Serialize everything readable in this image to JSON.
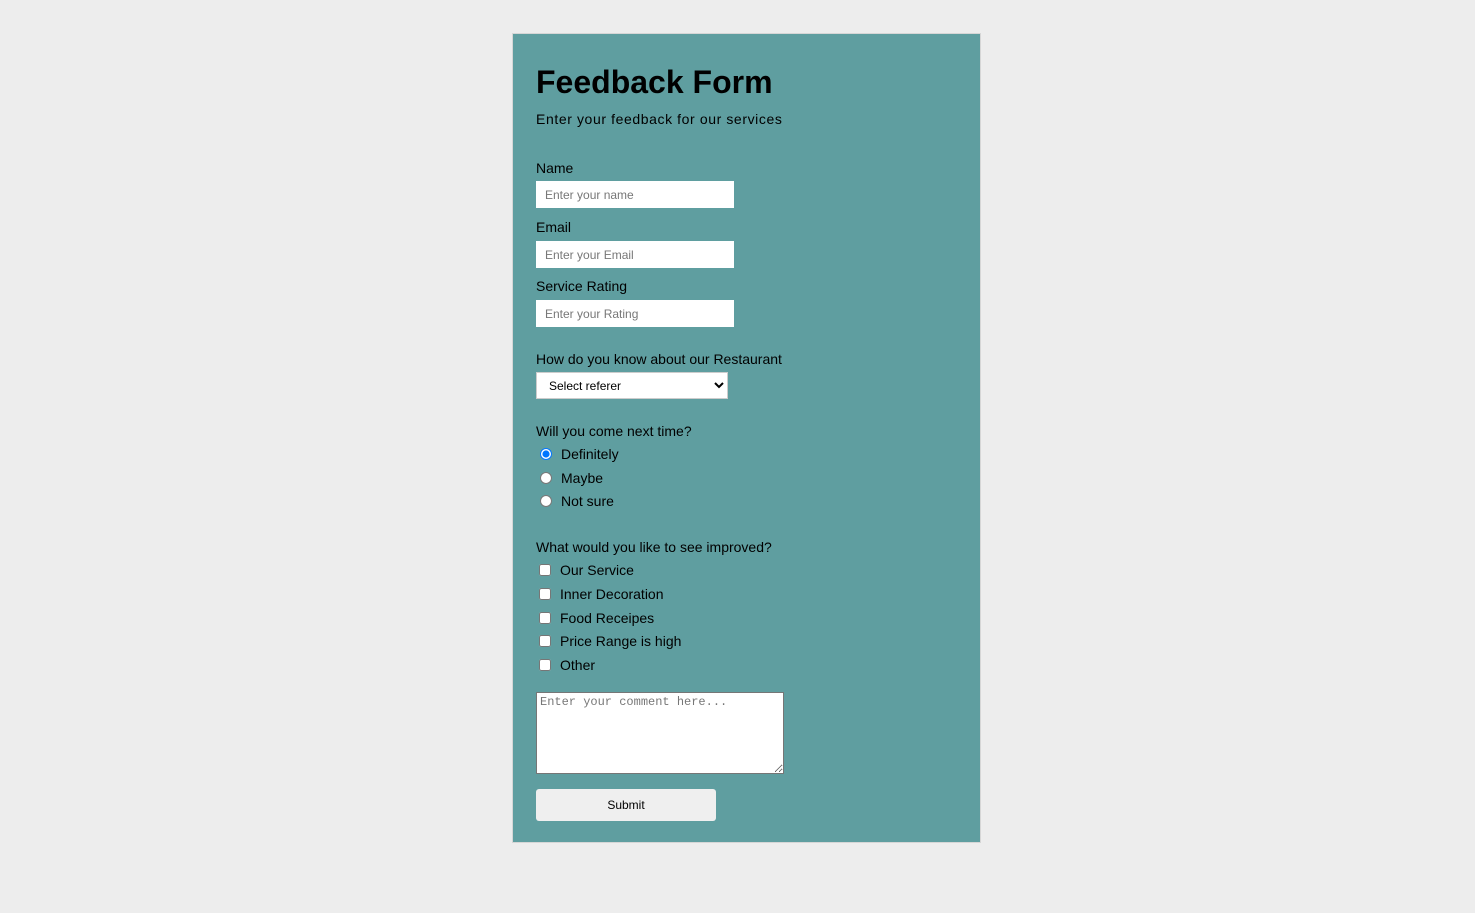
{
  "form": {
    "title": "Feedback Form",
    "subtitle": "Enter your feedback for our services",
    "name": {
      "label": "Name",
      "placeholder": "Enter your name"
    },
    "email": {
      "label": "Email",
      "placeholder": "Enter your Email"
    },
    "rating": {
      "label": "Service Rating",
      "placeholder": "Enter your Rating"
    },
    "referer": {
      "label": "How do you know about our Restaurant",
      "selected": "Select referer"
    },
    "return_visit": {
      "label": "Will you come next time?",
      "options": [
        "Definitely",
        "Maybe",
        "Not sure"
      ],
      "selected": "Definitely"
    },
    "improve": {
      "label": "What would you like to see improved?",
      "options": [
        "Our Service",
        "Inner Decoration",
        "Food Receipes",
        "Price Range is high",
        "Other"
      ]
    },
    "comment": {
      "placeholder": "Enter your comment here..."
    },
    "submit_label": "Submit"
  },
  "colors": {
    "page_background": "#ededed",
    "card_background": "#5f9ea0"
  }
}
